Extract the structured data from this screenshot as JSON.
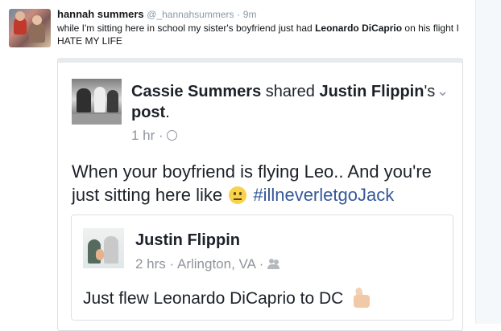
{
  "tweet": {
    "name": "hannah summers",
    "handle": "@_hannahsummers",
    "separator": "·",
    "time": "9m",
    "text_part1": "while I'm sitting here in school my sister's boyfriend just had ",
    "text_bold": "Leonardo DiCaprio",
    "text_part2": " on his flight I HATE MY LIFE"
  },
  "fb_post": {
    "sharer": "Cassie Summers",
    "shared_word": " shared ",
    "original_author": "Justin Flippin",
    "possessive": "'s ",
    "post_word": "post",
    "period": ".",
    "time": "1 hr",
    "dot": "·",
    "privacy_icon": "globe-icon",
    "menu_icon": "chevron-down-icon",
    "text": "When your boyfriend is flying Leo.. And you're just sitting here like ",
    "emoji": "neutral-face-emoji",
    "hashtag": "#illneverletgoJack"
  },
  "inner_post": {
    "author": "Justin Flippin",
    "time": "2 hrs",
    "dot1": "·",
    "location": "Arlington, VA",
    "dot2": "·",
    "audience_icon": "friends-icon",
    "text": "Just flew Leonardo DiCaprio to DC ",
    "emoji": "thumbs-up-emoji"
  },
  "colors": {
    "twitter_gray": "#8899a6",
    "facebook_link": "#365899",
    "facebook_text": "#1d2129",
    "facebook_meta": "#90949c"
  }
}
